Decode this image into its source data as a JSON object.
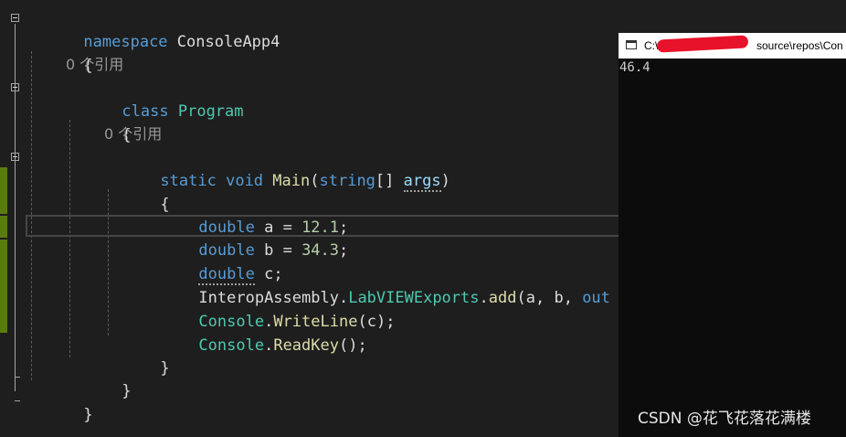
{
  "editor": {
    "references": "0 个引用",
    "tokens": {
      "namespace_kw": "namespace",
      "namespace_name": "ConsoleApp4",
      "open_brace": "{",
      "close_brace": "}",
      "class_kw": "class",
      "class_name": "Program",
      "static_kw": "static",
      "void_kw": "void",
      "main_name": "Main",
      "open_paren": "(",
      "string_kw": "string",
      "array_brackets": "[]",
      "args_param": "args",
      "close_paren": ")",
      "double_kw": "double",
      "var_a": "a",
      "var_b": "b",
      "var_c": "c",
      "equals": " = ",
      "value_a": "12.1",
      "value_b": "34.3",
      "semicolon": ";",
      "dot": ".",
      "comma": ", ",
      "interop_assembly": "InteropAssembly",
      "labview_exports": "LabVIEWExports",
      "add_method": "add",
      "out_kw": "out",
      "console_class": "Console",
      "writeline_method": "WriteLine",
      "readkey_method": "ReadKey",
      "empty_parens": "()"
    }
  },
  "console": {
    "title_start": "C:\\U",
    "title_end": "source\\repos\\Con",
    "output": "46.4"
  },
  "watermark": "CSDN @花飞花落花满楼",
  "colors": {
    "editor_background": "#1e1e1e",
    "keyword": "#569cd6",
    "type": "#4ec9b0",
    "method": "#dcdcaa",
    "number": "#b5cea8",
    "change_bar": "#587c0c",
    "console_background": "#0c0c0c"
  }
}
